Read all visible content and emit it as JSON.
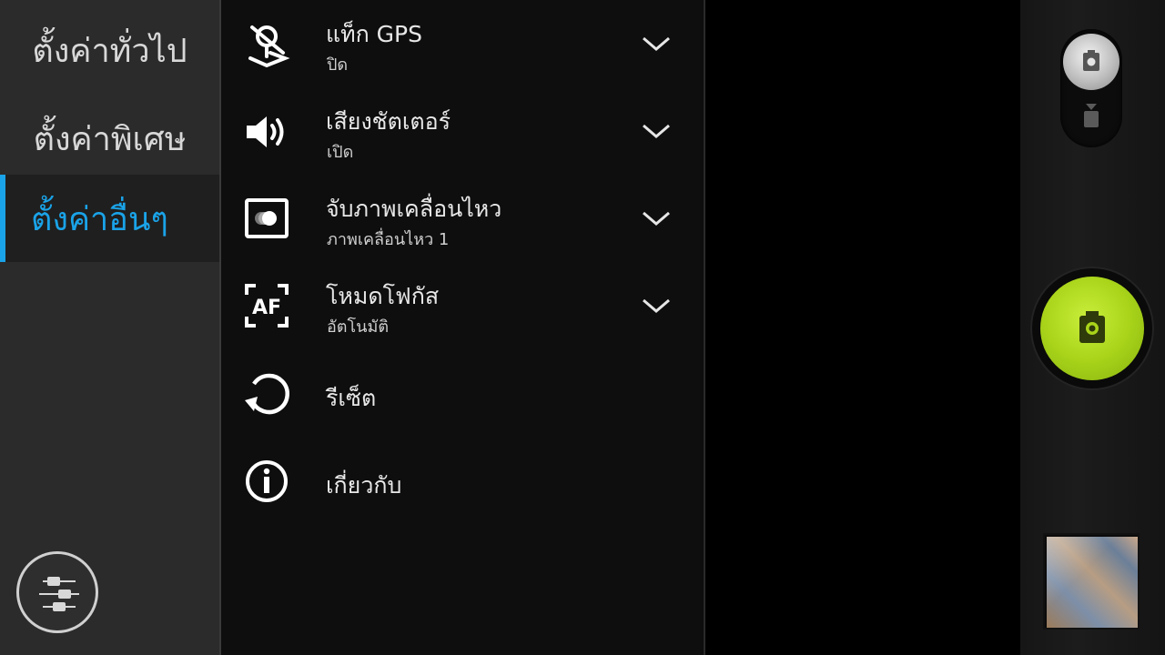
{
  "tabs": [
    {
      "label": "ตั้งค่าทั่วไป",
      "active": false
    },
    {
      "label": "ตั้งค่าพิเศษ",
      "active": false
    },
    {
      "label": "ตั้งค่าอื่นๆ",
      "active": true
    }
  ],
  "settings": [
    {
      "title": "แท็ก GPS",
      "value": "ปิด",
      "icon": "gps-off-icon",
      "has_dropdown": true
    },
    {
      "title": "เสียงชัตเตอร์",
      "value": "เปิด",
      "icon": "speaker-icon",
      "has_dropdown": true
    },
    {
      "title": "จับภาพเคลื่อนไหว",
      "value": "ภาพเคลื่อนไหว 1",
      "icon": "motion-capture-icon",
      "has_dropdown": true
    },
    {
      "title": "โหมดโฟกัส",
      "value": "อัตโนมัติ",
      "icon": "af-focus-icon",
      "has_dropdown": true
    },
    {
      "title": "รีเซ็ต",
      "icon": "reset-icon",
      "has_dropdown": false
    },
    {
      "title": "เกี่ยวกับ",
      "icon": "info-icon",
      "has_dropdown": false
    }
  ],
  "colors": {
    "accent": "#1aa3e8",
    "shutter": "#a9d41a",
    "tabs_bg": "#2b2b2b",
    "list_bg": "#0e0e0e"
  }
}
